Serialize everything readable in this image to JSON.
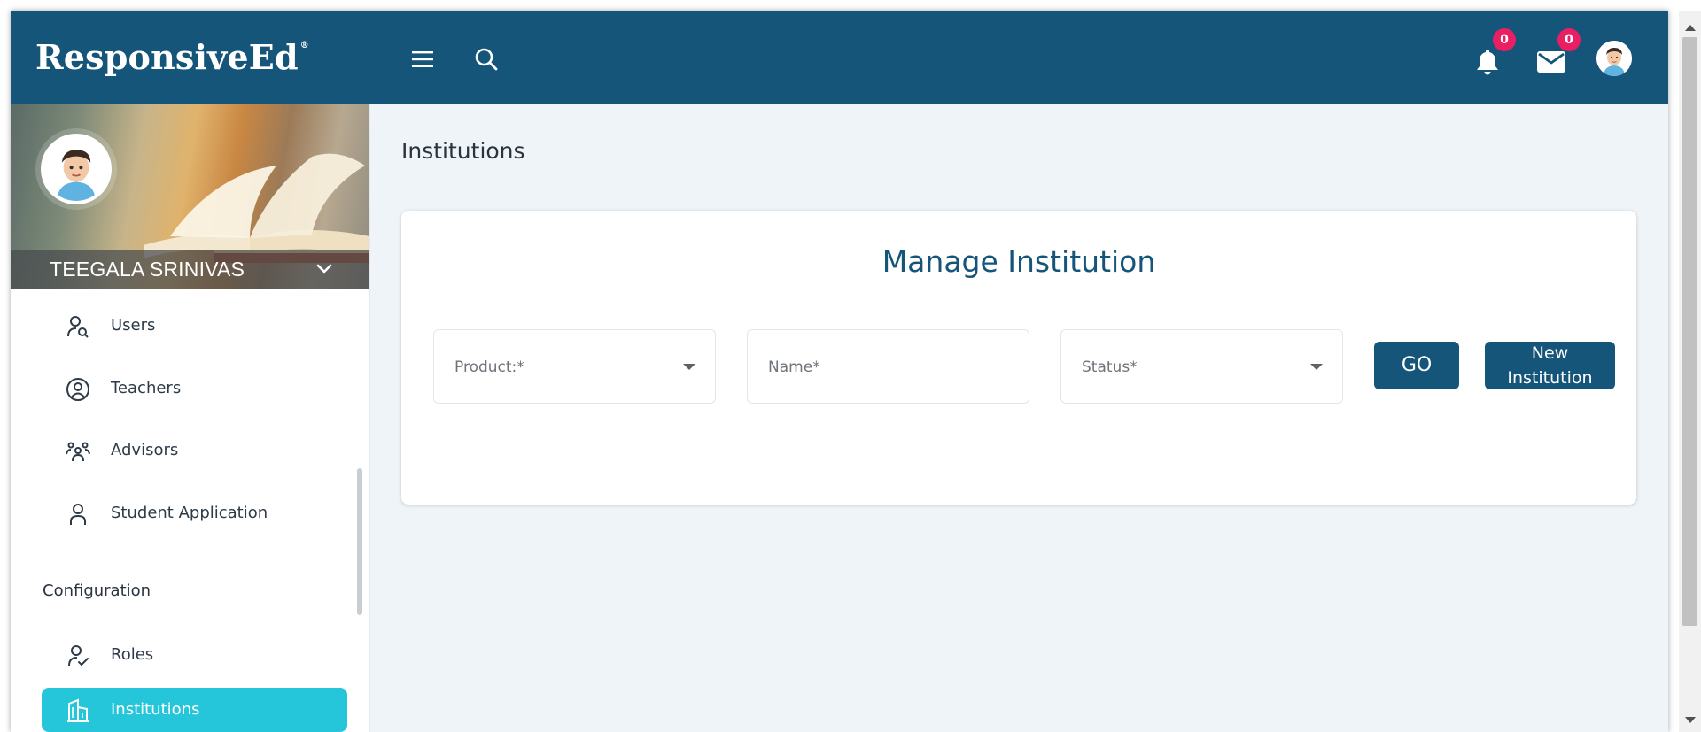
{
  "header": {
    "logo_text": "ResponsiveEd",
    "logo_mark": "®",
    "notifications_count": "0",
    "messages_count": "0",
    "icons": [
      "menu-icon",
      "search-icon",
      "bell-icon",
      "mail-icon"
    ],
    "background_color": "#155579"
  },
  "sidebar": {
    "profile_name": "TEEGALA SRINIVAS",
    "items": [
      {
        "label": "Users",
        "icon": "user-search-icon"
      },
      {
        "label": "Teachers",
        "icon": "user-circle-icon"
      },
      {
        "label": "Advisors",
        "icon": "users-group-icon"
      },
      {
        "label": "Student Application",
        "icon": "user-icon"
      }
    ],
    "section_label": "Configuration",
    "config_items": [
      {
        "label": "Roles",
        "icon": "user-check-icon"
      },
      {
        "label": "Institutions",
        "icon": "building-icon",
        "active": true
      }
    ],
    "active_color": "#26c6da"
  },
  "main": {
    "page_title": "Institutions",
    "card_title": "Manage Institution",
    "fields": {
      "product_placeholder": "Product:*",
      "name_placeholder": "Name*",
      "status_placeholder": "Status*"
    },
    "buttons": {
      "go_label": "GO",
      "new_line1": "New",
      "new_line2": "Institution"
    },
    "accent_color": "#155579"
  }
}
